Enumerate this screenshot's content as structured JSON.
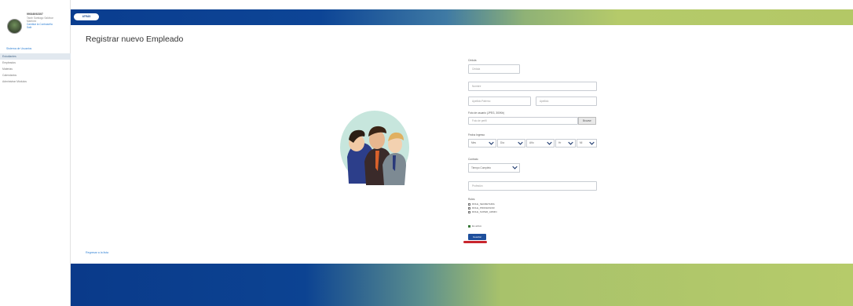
{
  "sidebar": {
    "profile": {
      "name": "99016092307",
      "lines": [
        "Tarah Santiago Saldivar",
        "Martinez"
      ],
      "link_lines": [
        "Cambiar la Contraseña",
        "Salir"
      ]
    },
    "top_link": "Sistema de Usuarios",
    "menu": [
      {
        "label": "Estudiantes",
        "active": true
      },
      {
        "label": "Empleados",
        "active": false
      },
      {
        "label": "Materias",
        "active": false
      },
      {
        "label": "Calendarios",
        "active": false
      },
      {
        "label": "Administrar Módulos",
        "active": false
      }
    ]
  },
  "header": {
    "back_label": "ATRÁS"
  },
  "main": {
    "title": "Registrar nuevo Empleado",
    "bottom_link": "Regresar a la lista"
  },
  "form": {
    "cedula_label": "Cédula",
    "cedula_placeholder": "Cédula",
    "name_placeholder": "Nombre",
    "surname_placeholder": "Apellido Paterno",
    "surname2_placeholder": "Apellido",
    "photo_label": "Foto de usuario (JPEG, 300Kb)",
    "photo_placeholder": "Foto de perfil",
    "browse_label": "Browse",
    "date_label": "Fecha Ingreso",
    "date_selects": [
      "Mes",
      "Día",
      "Año",
      "Hr",
      "Mi"
    ],
    "contract_label": "Contrato",
    "contract_value": "Tiempo Completo",
    "profession_placeholder": "Profesión",
    "roles_label": "Roles",
    "roles": [
      "ROLE_SECRETARIA",
      "ROLE_PROFESSOR",
      "ROLE_SUPER_ADMIN"
    ],
    "active_label": "Es activo",
    "save_label": "Guardar"
  },
  "colors": {
    "header_blue": "#0a3d8f",
    "header_green": "#b5ca6a",
    "link_blue": "#2d7fd3",
    "save_button": "#1e4f9c",
    "highlight_red": "#c8252d"
  }
}
